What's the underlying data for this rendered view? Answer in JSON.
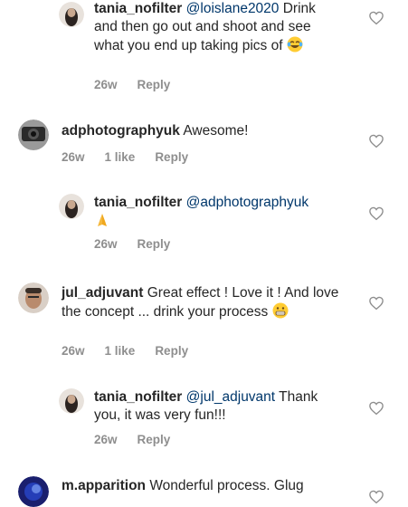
{
  "comments": [
    {
      "username": "tania_nofilter",
      "mention": "@loislane2020",
      "text": " Drink and then go out and shoot and see what you end up taking pics of",
      "emoji": "laughing-face-emoji",
      "time": "26w",
      "reply": "Reply"
    },
    {
      "username": "adphotographyuk",
      "text": "Awesome!",
      "time": "26w",
      "likes": "1 like",
      "reply": "Reply"
    },
    {
      "username": "tania_nofilter",
      "mention": "@adphotographyuk",
      "emoji": "folded-hands-emoji",
      "time": "26w",
      "reply": "Reply"
    },
    {
      "username": "jul_adjuvant",
      "text": "Great effect ! Love it ! And love the concept ... drink your process",
      "emoji": "grimacing-face-emoji",
      "time": "26w",
      "likes": "1 like",
      "reply": "Reply"
    },
    {
      "username": "tania_nofilter",
      "mention": "@jul_adjuvant",
      "text": " Thank you, it was very fun!!!",
      "time": "26w",
      "reply": "Reply"
    },
    {
      "username": "m.apparition",
      "text": "Wonderful process. Glug"
    }
  ],
  "colors": {
    "text": "#262626",
    "mention": "#00376b",
    "meta": "#8e8e8e",
    "heart": "#8e8e8e"
  }
}
